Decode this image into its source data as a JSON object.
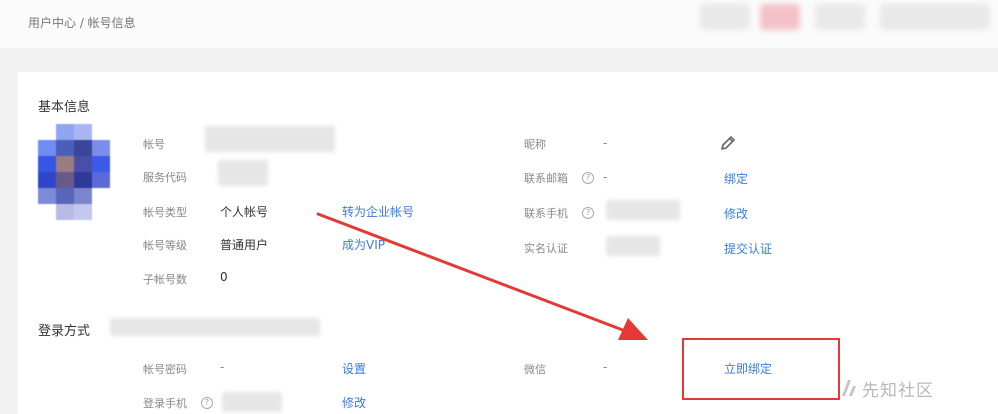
{
  "breadcrumb": "用户中心 / 帐号信息",
  "basic": {
    "title": "基本信息",
    "left": {
      "account_label": "帐号",
      "service_code_label": "服务代码",
      "type_label": "帐号类型",
      "type_value": "个人帐号",
      "type_link": "转为企业帐号",
      "level_label": "帐号等级",
      "level_value": "普通用户",
      "level_link": "成为VIP",
      "sub_label": "子帐号数",
      "sub_value": "0"
    },
    "right": {
      "nickname_label": "昵称",
      "nickname_value": "-",
      "email_label": "联系邮箱",
      "email_value": "-",
      "email_link": "绑定",
      "phone_label": "联系手机",
      "phone_link": "修改",
      "realname_label": "实名认证",
      "realname_link": "提交认证"
    }
  },
  "login": {
    "title": "登录方式",
    "password_label": "帐号密码",
    "password_value": "-",
    "password_link": "设置",
    "phone_label": "登录手机",
    "phone_link": "修改",
    "wechat_label": "微信",
    "wechat_value": "-",
    "wechat_link": "立即绑定"
  },
  "help_icon": "?",
  "watermark": "先知社区",
  "colors": {
    "link": "#3a7bdc",
    "highlight": "#e53935"
  }
}
